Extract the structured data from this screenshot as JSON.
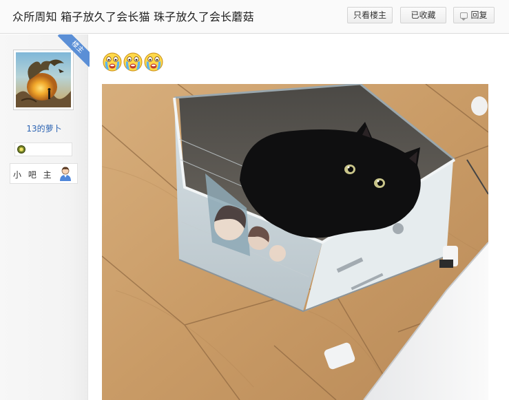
{
  "header": {
    "title": "众所周知 箱子放久了会长猫 珠子放久了会长蘑菇",
    "buttons": {
      "only_op": "只看楼主",
      "collected": "已收藏",
      "reply": "回复"
    }
  },
  "author": {
    "ribbon_label": "楼主",
    "username": "13的萝卜",
    "role": "小 吧 主",
    "avatar_icon": "dragon-landscape-avatar",
    "level_icon": "level-medal-icon",
    "role_icon": "person-icon"
  },
  "post": {
    "emojis": [
      "crying-face-icon",
      "crying-face-icon",
      "crying-face-icon"
    ],
    "image": "black-cat-in-cardboard-box-photo"
  },
  "colors": {
    "username": "#2d64b3",
    "ribbon": "#5b8fd6",
    "header_bg": "#fafafa",
    "sidebar_bg": "#f3f3f3"
  }
}
